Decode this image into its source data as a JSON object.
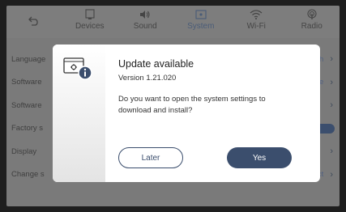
{
  "nav": {
    "back_icon": "back-arrow-icon",
    "items": [
      {
        "label": "Devices",
        "icon": "devices-icon"
      },
      {
        "label": "Sound",
        "icon": "speaker-icon"
      },
      {
        "label": "System",
        "icon": "system-icon"
      },
      {
        "label": "Wi-Fi",
        "icon": "wifi-icon"
      },
      {
        "label": "Radio",
        "icon": "radio-icon"
      }
    ],
    "active": "System"
  },
  "settings": {
    "rows": [
      {
        "label": "Language",
        "value": "lish"
      },
      {
        "label": "Software",
        "value": "ble"
      },
      {
        "label": "Software",
        "value": ""
      },
      {
        "label": "Factory s",
        "value": ""
      },
      {
        "label": "Display",
        "value": ""
      },
      {
        "label": "Change s",
        "value": "ect"
      }
    ]
  },
  "dialog": {
    "icon": "system-update-info-icon",
    "title": "Update available",
    "version": "Version 1.21.020",
    "message": "Do you want to open the system settings to download and install?",
    "later_label": "Later",
    "yes_label": "Yes"
  },
  "colors": {
    "accent": "#3b4e6d",
    "overlay": "#7a7a7a"
  }
}
